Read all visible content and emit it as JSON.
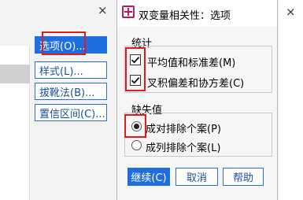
{
  "parent": {
    "close_glyph": "×",
    "buttons": [
      {
        "label": "选项(O)..."
      },
      {
        "label": "样式(L)..."
      },
      {
        "label": "拔靴法(B)..."
      },
      {
        "label": "置信区间(C)..."
      }
    ]
  },
  "dialog": {
    "title": "双变量相关性：选项",
    "statistics_group": {
      "title": "统计",
      "options": [
        {
          "label": "平均值和标准差(M)",
          "checked": true
        },
        {
          "label": "叉积偏差和协方差(C)",
          "checked": true
        }
      ]
    },
    "missing_group": {
      "title": "缺失值",
      "options": [
        {
          "label": "成对排除个案(P)",
          "selected": true
        },
        {
          "label": "成列排除个案(L)",
          "selected": false
        }
      ]
    },
    "buttons": {
      "continue": "继续(C)",
      "cancel": "取消",
      "help": "帮助"
    }
  },
  "right_panel": {
    "close_glyph": "×"
  },
  "colors": {
    "accent": "#1e6ee0",
    "highlight": "#e01b1b",
    "icon": "#c2185b"
  }
}
